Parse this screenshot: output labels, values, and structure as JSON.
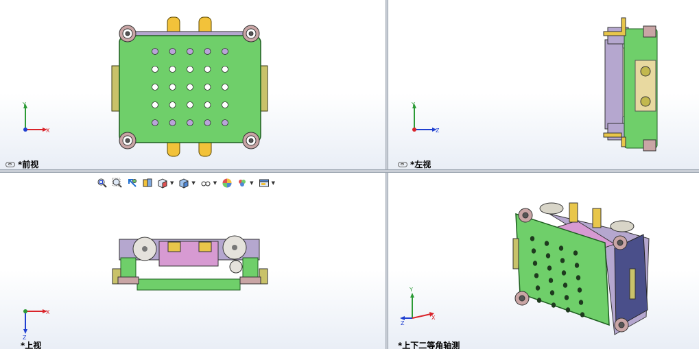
{
  "viewports": {
    "front": {
      "label": "*前视",
      "axes": [
        "Y",
        "X"
      ]
    },
    "left": {
      "label": "*左视",
      "axes": [
        "Y",
        "Z"
      ]
    },
    "top": {
      "label": "*上视",
      "axes": [
        "X",
        "Z"
      ]
    },
    "iso": {
      "label": "*上下二等角轴测",
      "axes": [
        "Y",
        "X",
        "Z"
      ]
    }
  },
  "toolbar": {
    "icons": [
      "zoom-to-fit-icon",
      "zoom-area-icon",
      "previous-view-icon",
      "section-view-icon",
      "view-orientation-icon",
      "display-style-icon",
      "hide-show-items-icon",
      "edit-appearance-icon",
      "apply-scene-icon",
      "view-settings-icon"
    ]
  },
  "colors": {
    "plate": "#6fcf6a",
    "plate_edge": "#1e6d22",
    "brass": "#e8c64a",
    "purple": "#b9a3d9",
    "steel": "#b7b3c9",
    "axis_x": "#d9232a",
    "axis_y": "#2b9a35",
    "axis_z": "#1f3fd0"
  }
}
